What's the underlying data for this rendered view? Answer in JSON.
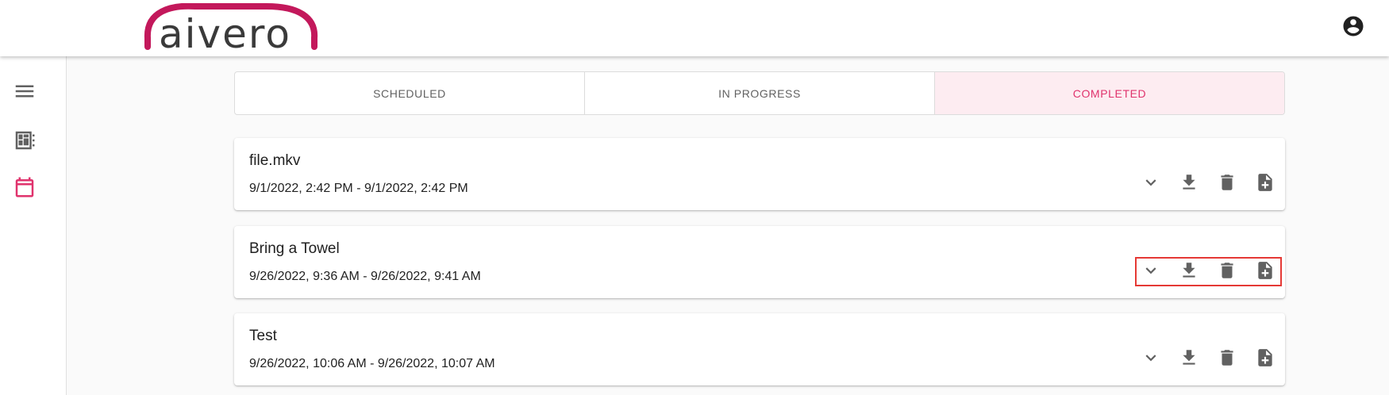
{
  "header": {
    "logo_text": "aivero",
    "brand_color": "#c3185b"
  },
  "sidebar": {
    "items": [
      {
        "icon": "menu-icon",
        "active": false
      },
      {
        "icon": "dashboard-icon",
        "active": false
      },
      {
        "icon": "calendar-icon",
        "active": true
      }
    ],
    "active_color": "#e0336d"
  },
  "tabs": [
    {
      "label": "SCHEDULED",
      "active": false
    },
    {
      "label": "IN PROGRESS",
      "active": false
    },
    {
      "label": "COMPLETED",
      "active": true
    }
  ],
  "jobs": [
    {
      "title": "file.mkv",
      "time_range": "9/1/2022, 2:42 PM - 9/1/2022, 2:42 PM",
      "highlighted": false
    },
    {
      "title": "Bring a Towel",
      "time_range": "9/26/2022, 9:36 AM - 9/26/2022, 9:41 AM",
      "highlighted": true
    },
    {
      "title": "Test",
      "time_range": "9/26/2022, 10:06 AM - 9/26/2022, 10:07 AM",
      "highlighted": false
    }
  ],
  "highlight_color": "#e53935"
}
